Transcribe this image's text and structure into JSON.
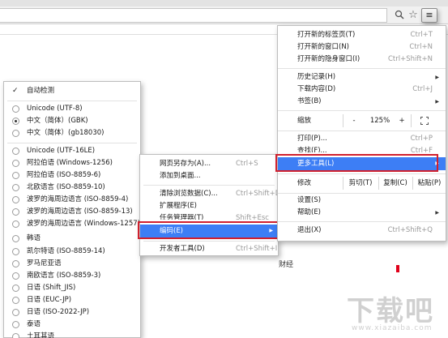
{
  "toolbar": {
    "zoom_icon": "magnifier-icon",
    "star_icon": "star-icon",
    "menu_icon": "hamburger-menu-icon",
    "menu_glyph": "≡",
    "star_glyph": "☆"
  },
  "main_menu": {
    "new_tab": {
      "label": "打开新的标签页(T)",
      "shortcut": "Ctrl+T"
    },
    "new_window": {
      "label": "打开新的窗口(N)",
      "shortcut": "Ctrl+N"
    },
    "incognito": {
      "label": "打开新的隐身窗口(I)",
      "shortcut": "Ctrl+Shift+N"
    },
    "history": {
      "label": "历史记录(H)"
    },
    "downloads": {
      "label": "下载内容(D)",
      "shortcut": "Ctrl+J"
    },
    "bookmarks": {
      "label": "书签(B)"
    },
    "zoom": {
      "label": "缩放",
      "minus": "-",
      "value": "125%",
      "plus": "+"
    },
    "print": {
      "label": "打印(P)...",
      "shortcut": "Ctrl+P"
    },
    "find": {
      "label": "查找(F)...",
      "shortcut": "Ctrl+F"
    },
    "more_tools": {
      "label": "更多工具(L)"
    },
    "edit": {
      "label": "修改",
      "cut": "剪切(T)",
      "copy": "复制(C)",
      "paste": "粘贴(P)"
    },
    "settings": {
      "label": "设置(S)"
    },
    "help": {
      "label": "帮助(E)"
    },
    "exit": {
      "label": "退出(X)",
      "shortcut": "Ctrl+Shift+Q"
    }
  },
  "tools_menu": {
    "save_page": {
      "label": "网页另存为(A)...",
      "shortcut": "Ctrl+S"
    },
    "add_desktop": {
      "label": "添加到桌面..."
    },
    "clear_data": {
      "label": "清除浏览数据(C)...",
      "shortcut": "Ctrl+Shift+Del"
    },
    "extensions": {
      "label": "扩展程序(E)"
    },
    "task_manager": {
      "label": "任务管理器(T)",
      "shortcut": "Shift+Esc"
    },
    "encoding": {
      "label": "编码(E)"
    },
    "devtools": {
      "label": "开发者工具(D)",
      "shortcut": "Ctrl+Shift+I"
    }
  },
  "encoding_menu": {
    "auto_detect": "自动检测",
    "items": [
      {
        "label": "Unicode (UTF-8)",
        "selected": false
      },
      {
        "label": "中文（简体）(GBK)",
        "selected": true
      },
      {
        "label": "中文（简体）(gb18030)",
        "selected": false
      },
      {
        "label": "Unicode (UTF-16LE)",
        "selected": false
      },
      {
        "label": "阿拉伯语 (Windows-1256)",
        "selected": false
      },
      {
        "label": "阿拉伯语 (ISO-8859-6)",
        "selected": false
      },
      {
        "label": "北欧语言 (ISO-8859-10)",
        "selected": false
      },
      {
        "label": "波罗的海周边语言 (ISO-8859-4)",
        "selected": false
      },
      {
        "label": "波罗的海周边语言 (ISO-8859-13)",
        "selected": false
      },
      {
        "label": "波罗的海周边语言 (Windows-1257)",
        "selected": false
      },
      {
        "label": "韩语",
        "selected": false
      },
      {
        "label": "凯尔特语 (ISO-8859-14)",
        "selected": false
      },
      {
        "label": "罗马尼亚语",
        "selected": false
      },
      {
        "label": "南欧语言 (ISO-8859-3)",
        "selected": false
      },
      {
        "label": "日语 (Shift_JIS)",
        "selected": false
      },
      {
        "label": "日语 (EUC-JP)",
        "selected": false
      },
      {
        "label": "日语 (ISO-2022-JP)",
        "selected": false
      },
      {
        "label": "泰语",
        "selected": false
      },
      {
        "label": "土耳其语",
        "selected": false
      }
    ]
  },
  "page": {
    "background_text": "财经",
    "watermark_big": "下载吧",
    "watermark_small": "www.xiazaiba.com",
    "accent_red": "#d0202e",
    "highlight_blue": "#3d7ef5"
  }
}
